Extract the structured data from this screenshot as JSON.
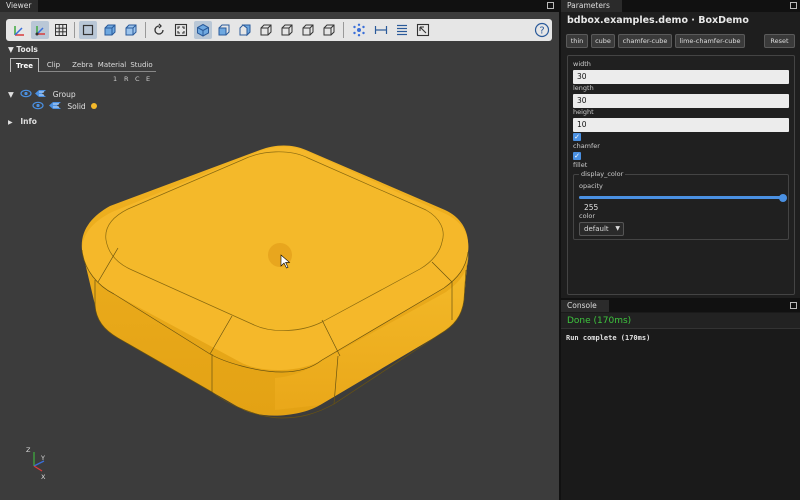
{
  "viewer": {
    "tab_label": "Viewer",
    "tools": {
      "header": "Tools",
      "tabs": [
        "Tree",
        "Clip",
        "Zebra",
        "Material",
        "Studio"
      ],
      "rce_letters": [
        "1",
        "R",
        "C",
        "E"
      ],
      "tree": {
        "group_label": "Group",
        "solid_label": "Solid"
      },
      "info_label": "Info"
    },
    "axes": {
      "z": "Z",
      "y": "Y",
      "x": "X"
    },
    "help_label": "?",
    "model_color": "#f4b92a"
  },
  "params": {
    "tab_label": "Parameters",
    "title": "bdbox.examples.demo · BoxDemo",
    "presets": [
      "thin",
      "cube",
      "chamfer-cube",
      "lime-chamfer-cube"
    ],
    "reset_label": "Reset",
    "width_label": "width",
    "width_value": "30",
    "length_label": "length",
    "length_value": "30",
    "height_label": "height",
    "height_value": "10",
    "chamfer_label": "chamfer",
    "fillet_label": "fillet",
    "display_color_legend": "display_color",
    "opacity_label": "opacity",
    "opacity_value": "255",
    "opacity_fraction": 1.0,
    "color_label": "color",
    "color_value": "default",
    "accent_color": "#4a90e2"
  },
  "console": {
    "tab_label": "Console",
    "status": "Done (170ms)",
    "log": "Run complete (170ms)",
    "status_color": "#3ec43e"
  }
}
